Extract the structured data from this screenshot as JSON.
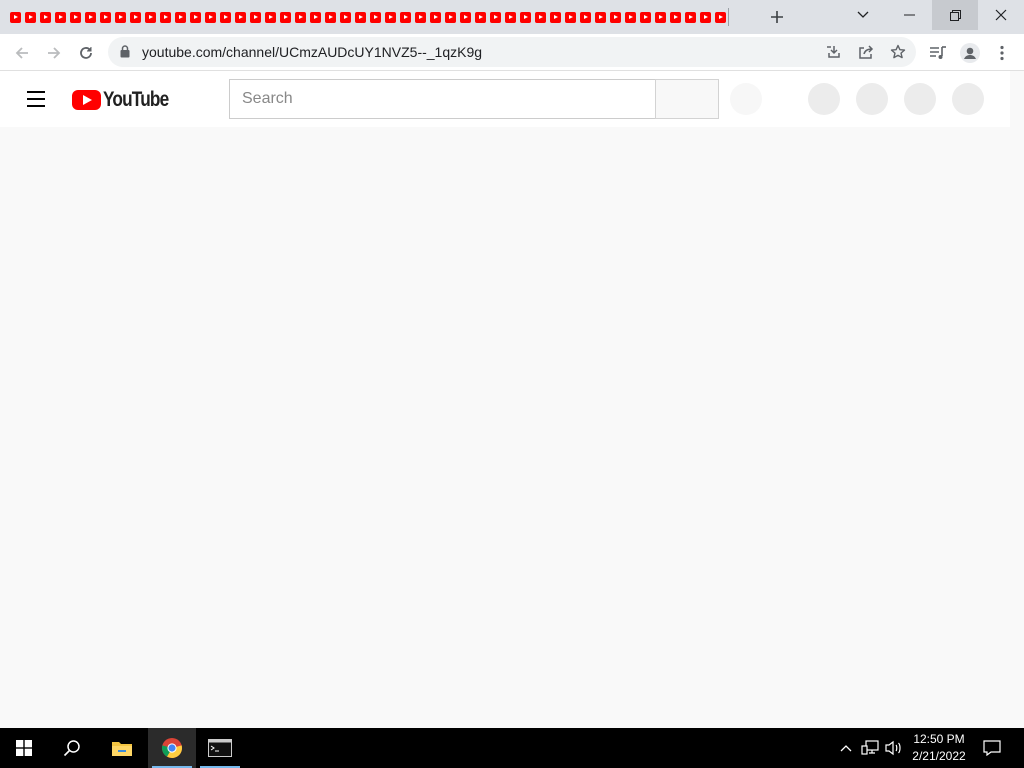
{
  "browser": {
    "tab_favicon": "youtube-favicon",
    "tab_count": 48,
    "new_tab_icon": "plus-icon",
    "window_controls": [
      "tab-search-chevron-icon",
      "minimize-icon",
      "restore-icon",
      "close-icon"
    ],
    "url": "youtube.com/channel/UCmzAUDcUY1NVZ5--_1qzK9g"
  },
  "youtube": {
    "logo_text": "YouTube",
    "search_placeholder": "Search",
    "brand_red": "#ff0000"
  },
  "taskbar": {
    "apps": [
      "windows-start-icon",
      "search-icon",
      "file-explorer-icon",
      "chrome-icon",
      "command-prompt-icon"
    ],
    "time": "12:50 PM",
    "date": "2/21/2022"
  }
}
